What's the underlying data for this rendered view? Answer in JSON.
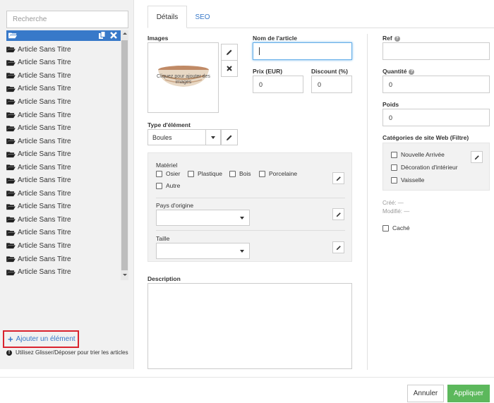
{
  "left_panel": {
    "search_placeholder": "Recherche",
    "items": [
      "Article Sans Titre",
      "Article Sans Titre",
      "Article Sans Titre",
      "Article Sans Titre",
      "Article Sans Titre",
      "Article Sans Titre",
      "Article Sans Titre",
      "Article Sans Titre",
      "Article Sans Titre",
      "Article Sans Titre",
      "Article Sans Titre",
      "Article Sans Titre",
      "Article Sans Titre",
      "Article Sans Titre",
      "Article Sans Titre",
      "Article Sans Titre",
      "Article Sans Titre",
      "Article Sans Titre"
    ],
    "add_label": "Ajouter un élément",
    "hint": "Utilisez Glisser/Déposer pour trier les articles"
  },
  "tabs": [
    {
      "label": "Détails",
      "active": true
    },
    {
      "label": "SEO",
      "active": false
    }
  ],
  "details": {
    "images_label": "Images",
    "image_placeholder": "Cliquez pour ajouter des images",
    "name_label": "Nom de l'article",
    "name_value": "",
    "price_label": "Prix (EUR)",
    "price_value": "0",
    "discount_label": "Discount (%)",
    "discount_value": "0",
    "type_label": "Type d'élément",
    "type_value": "Boules",
    "material_label": "Matériel",
    "materials": [
      "Osier",
      "Plastique",
      "Bois",
      "Porcelaine",
      "Autre"
    ],
    "country_label": "Pays d'origine",
    "country_value": "",
    "size_label": "Taille",
    "size_value": "",
    "description_label": "Description",
    "description_value": ""
  },
  "right_column": {
    "ref_label": "Ref",
    "ref_value": "",
    "qty_label": "Quantité",
    "qty_value": "0",
    "weight_label": "Poids",
    "weight_value": "0",
    "categories_label": "Catégories de site Web (Filtre)",
    "categories": [
      "Nouvelle Arrivée",
      "Décoration d'intérieur",
      "Vaisselle"
    ],
    "created_label": "Créé: —",
    "modified_label": "Modifié: —",
    "hidden_label": "Caché"
  },
  "footer": {
    "cancel_label": "Annuler",
    "apply_label": "Appliquer"
  },
  "colors": {
    "accent": "#3879c9",
    "apply_green": "#5cb85c",
    "highlight_red": "#d9232e",
    "input_focus": "#66afe9"
  }
}
